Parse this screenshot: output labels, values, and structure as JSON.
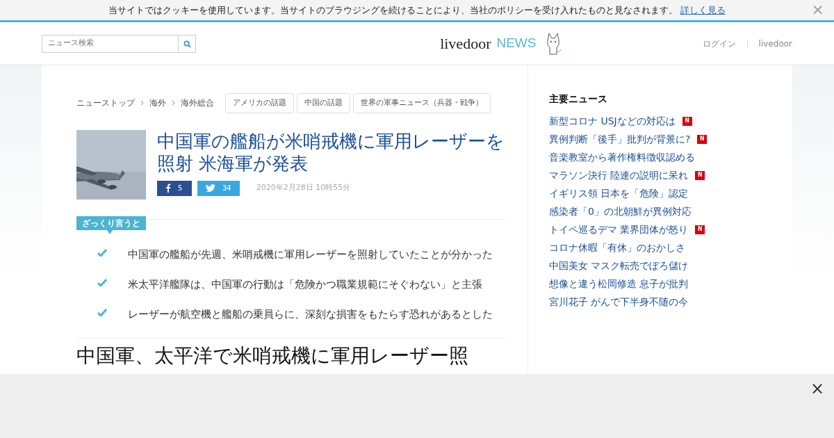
{
  "cookie_bar": {
    "message": "当サイトではクッキーを使用しています。当サイトのブラウジングを続けることにより、当社のポリシーを受け入れたものと見なされます。",
    "link": "詳しく見る",
    "close": "×"
  },
  "header": {
    "search": {
      "placeholder": "ニュース検索"
    },
    "logo": {
      "brand": "livedoor",
      "product": "NEWS"
    },
    "nav": [
      "ログイン",
      "livedoor"
    ]
  },
  "breadcrumbs": [
    "ニューストップ",
    "海外",
    "海外総合"
  ],
  "tags": [
    "アメリカの話題",
    "中国の話題",
    "世界の軍事ニュース（兵器・戦争）"
  ],
  "article": {
    "title": "中国軍の艦船が米哨戒機に軍用レーザーを照射 米海軍が発表",
    "share": [
      {
        "kind": "facebook",
        "count": "5"
      },
      {
        "kind": "twitter",
        "count": "34"
      }
    ],
    "date": "2020年2月28日 10時55分"
  },
  "summary": {
    "label": "ざっくり言うと",
    "points": [
      "中国軍の艦船が先週、米哨戒機に軍用レーザーを照射していたことが分かった",
      "米太平洋艦隊は、中国軍の行動は「危険かつ職業規範にそぐわない」と主張",
      "レーザーが航空機と艦船の乗員らに、深刻な損害をもたらす恐れがあるとした"
    ]
  },
  "body_heading": "中国軍、太平洋で米哨戒機に軍用レーザー照",
  "sidebar": {
    "title": "主要ニュース",
    "items": [
      {
        "text": "新型コロナ USJなどの対応は",
        "badge": "N"
      },
      {
        "text": "異例判断「後手」批判が背景に?",
        "badge": "N"
      },
      {
        "text": "音楽教室から著作権料徴収認める"
      },
      {
        "text": "マラソン決行 陸連の説明に呆れ",
        "badge": "N"
      },
      {
        "text": "イギリス領 日本を「危険」認定"
      },
      {
        "text": "感染者「0」の北朝鮮が異例対応"
      },
      {
        "text": "トイペ巡るデマ 業界団体が怒り",
        "badge": "N"
      },
      {
        "text": "コロナ休暇「有休」のおかしさ"
      },
      {
        "text": "中国美女 マスク転売でぼろ儲け"
      },
      {
        "text": "想像と違う松岡修造 息子が批判"
      },
      {
        "text": "宮川花子 がんで下半身不随の今"
      }
    ]
  },
  "ad_overlay": {
    "close": "×"
  }
}
